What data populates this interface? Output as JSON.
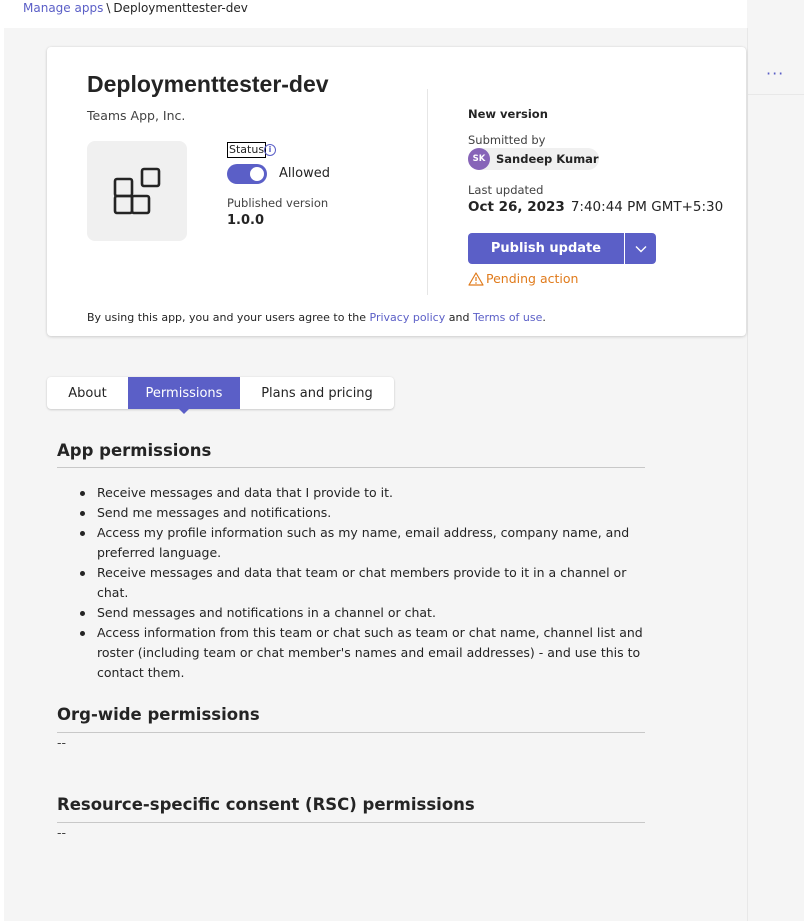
{
  "breadcrumb": {
    "parent": "Manage apps",
    "separator": "\\",
    "current": "Deploymenttester-dev"
  },
  "right_rail": {
    "more_label": "···"
  },
  "app": {
    "name": "Deploymenttester-dev",
    "publisher": "Teams App, Inc.",
    "icon": "app-grid-icon",
    "status_label": "Status",
    "status_value": "Allowed",
    "status_enabled": true,
    "published_version_label": "Published version",
    "published_version": "1.0.0"
  },
  "new_version": {
    "heading": "New version",
    "submitted_by_label": "Submitted by",
    "submitter_initials": "SK",
    "submitter_name": "Sandeep Kumar",
    "last_updated_label": "Last updated",
    "last_updated_date": "Oct 26, 2023",
    "last_updated_time": "7:40:44 PM GMT+5:30",
    "publish_button": "Publish update",
    "pending_text": "Pending action"
  },
  "terms": {
    "prefix": "By using this app, you and your users agree to the",
    "privacy_link": "Privacy policy",
    "and": "and",
    "terms_link": "Terms of use",
    "suffix": "."
  },
  "tabs": [
    {
      "label": "About",
      "active": false
    },
    {
      "label": "Permissions",
      "active": true
    },
    {
      "label": "Plans and pricing",
      "active": false
    }
  ],
  "permissions": {
    "app_title": "App permissions",
    "app_items": [
      "Receive messages and data that I provide to it.",
      "Send me messages and notifications.",
      "Access my profile information such as my name, email address, company name, and preferred language.",
      "Receive messages and data that team or chat members provide to it in a channel or chat.",
      "Send messages and notifications in a channel or chat.",
      "Access information from this team or chat such as team or chat name, channel list and roster (including team or chat member's names and email addresses) - and use this to contact them."
    ],
    "org_title": "Org-wide permissions",
    "org_value": "--",
    "rsc_title": "Resource-specific consent (RSC) permissions",
    "rsc_value": "--"
  },
  "colors": {
    "accent": "#5b5fc7",
    "warning": "#e07b1c",
    "avatar": "#8764b8"
  }
}
